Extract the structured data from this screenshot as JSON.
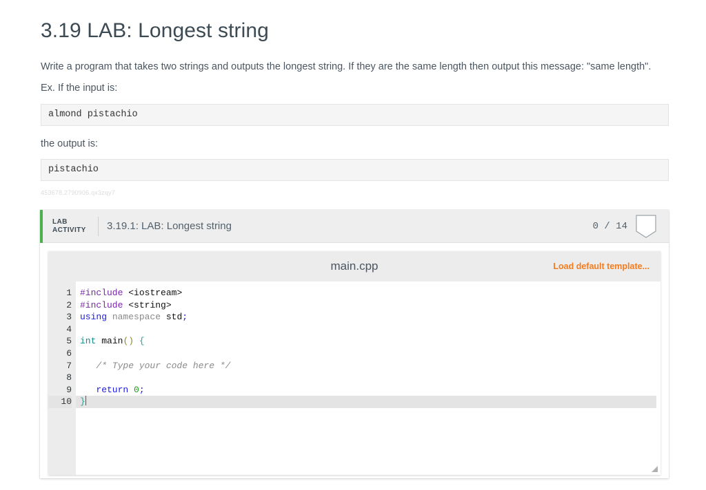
{
  "page": {
    "title": "3.19 LAB: Longest string",
    "description": "Write a program that takes two strings and outputs the longest string. If they are the same length then output this message: \"same length\".",
    "example_intro": "Ex. If the input is:",
    "example_input": "almond pistachio",
    "output_intro": "the output is:",
    "example_output": "pistachio",
    "token": "453678.2790906.qx3zqy7"
  },
  "lab_activity": {
    "badge_line1": "LAB",
    "badge_line2": "ACTIVITY",
    "name": "3.19.1: LAB: Longest string",
    "score": "0 / 14",
    "score_earned": 0,
    "score_total": 14,
    "accent_color": "#4caf50"
  },
  "editor": {
    "file_name": "main.cpp",
    "load_default_label": "Load default template...",
    "load_default_color": "#f47c20",
    "active_line": 10,
    "gutter": [
      "1",
      "2",
      "3",
      "4",
      "5",
      "6",
      "7",
      "8",
      "9",
      "10"
    ],
    "lines": [
      {
        "n": 1,
        "tokens": [
          {
            "t": "#include",
            "c": "k-pre"
          },
          {
            "t": " ",
            "c": "k-plain"
          },
          {
            "t": "<iostream>",
            "c": "k-plain"
          }
        ]
      },
      {
        "n": 2,
        "tokens": [
          {
            "t": "#include",
            "c": "k-pre"
          },
          {
            "t": " ",
            "c": "k-plain"
          },
          {
            "t": "<string>",
            "c": "k-plain"
          }
        ]
      },
      {
        "n": 3,
        "tokens": [
          {
            "t": "using",
            "c": "k-blue"
          },
          {
            "t": " ",
            "c": "k-plain"
          },
          {
            "t": "namespace",
            "c": "k-gray"
          },
          {
            "t": " ",
            "c": "k-plain"
          },
          {
            "t": "std",
            "c": "k-plain"
          },
          {
            "t": ";",
            "c": "k-blue"
          }
        ]
      },
      {
        "n": 4,
        "tokens": []
      },
      {
        "n": 5,
        "tokens": [
          {
            "t": "int",
            "c": "k-type"
          },
          {
            "t": " ",
            "c": "k-plain"
          },
          {
            "t": "main",
            "c": "k-plain"
          },
          {
            "t": "()",
            "c": "k-paren"
          },
          {
            "t": " ",
            "c": "k-plain"
          },
          {
            "t": "{",
            "c": "k-brace"
          }
        ]
      },
      {
        "n": 6,
        "tokens": []
      },
      {
        "n": 7,
        "tokens": [
          {
            "t": "   /* Type your code here */",
            "c": "k-cmt"
          }
        ]
      },
      {
        "n": 8,
        "tokens": []
      },
      {
        "n": 9,
        "tokens": [
          {
            "t": "   ",
            "c": "k-plain"
          },
          {
            "t": "return",
            "c": "k-blue"
          },
          {
            "t": " ",
            "c": "k-plain"
          },
          {
            "t": "0",
            "c": "k-num"
          },
          {
            "t": ";",
            "c": "k-blue"
          }
        ]
      },
      {
        "n": 10,
        "tokens": [
          {
            "t": "}",
            "c": "k-brace"
          }
        ]
      }
    ]
  }
}
